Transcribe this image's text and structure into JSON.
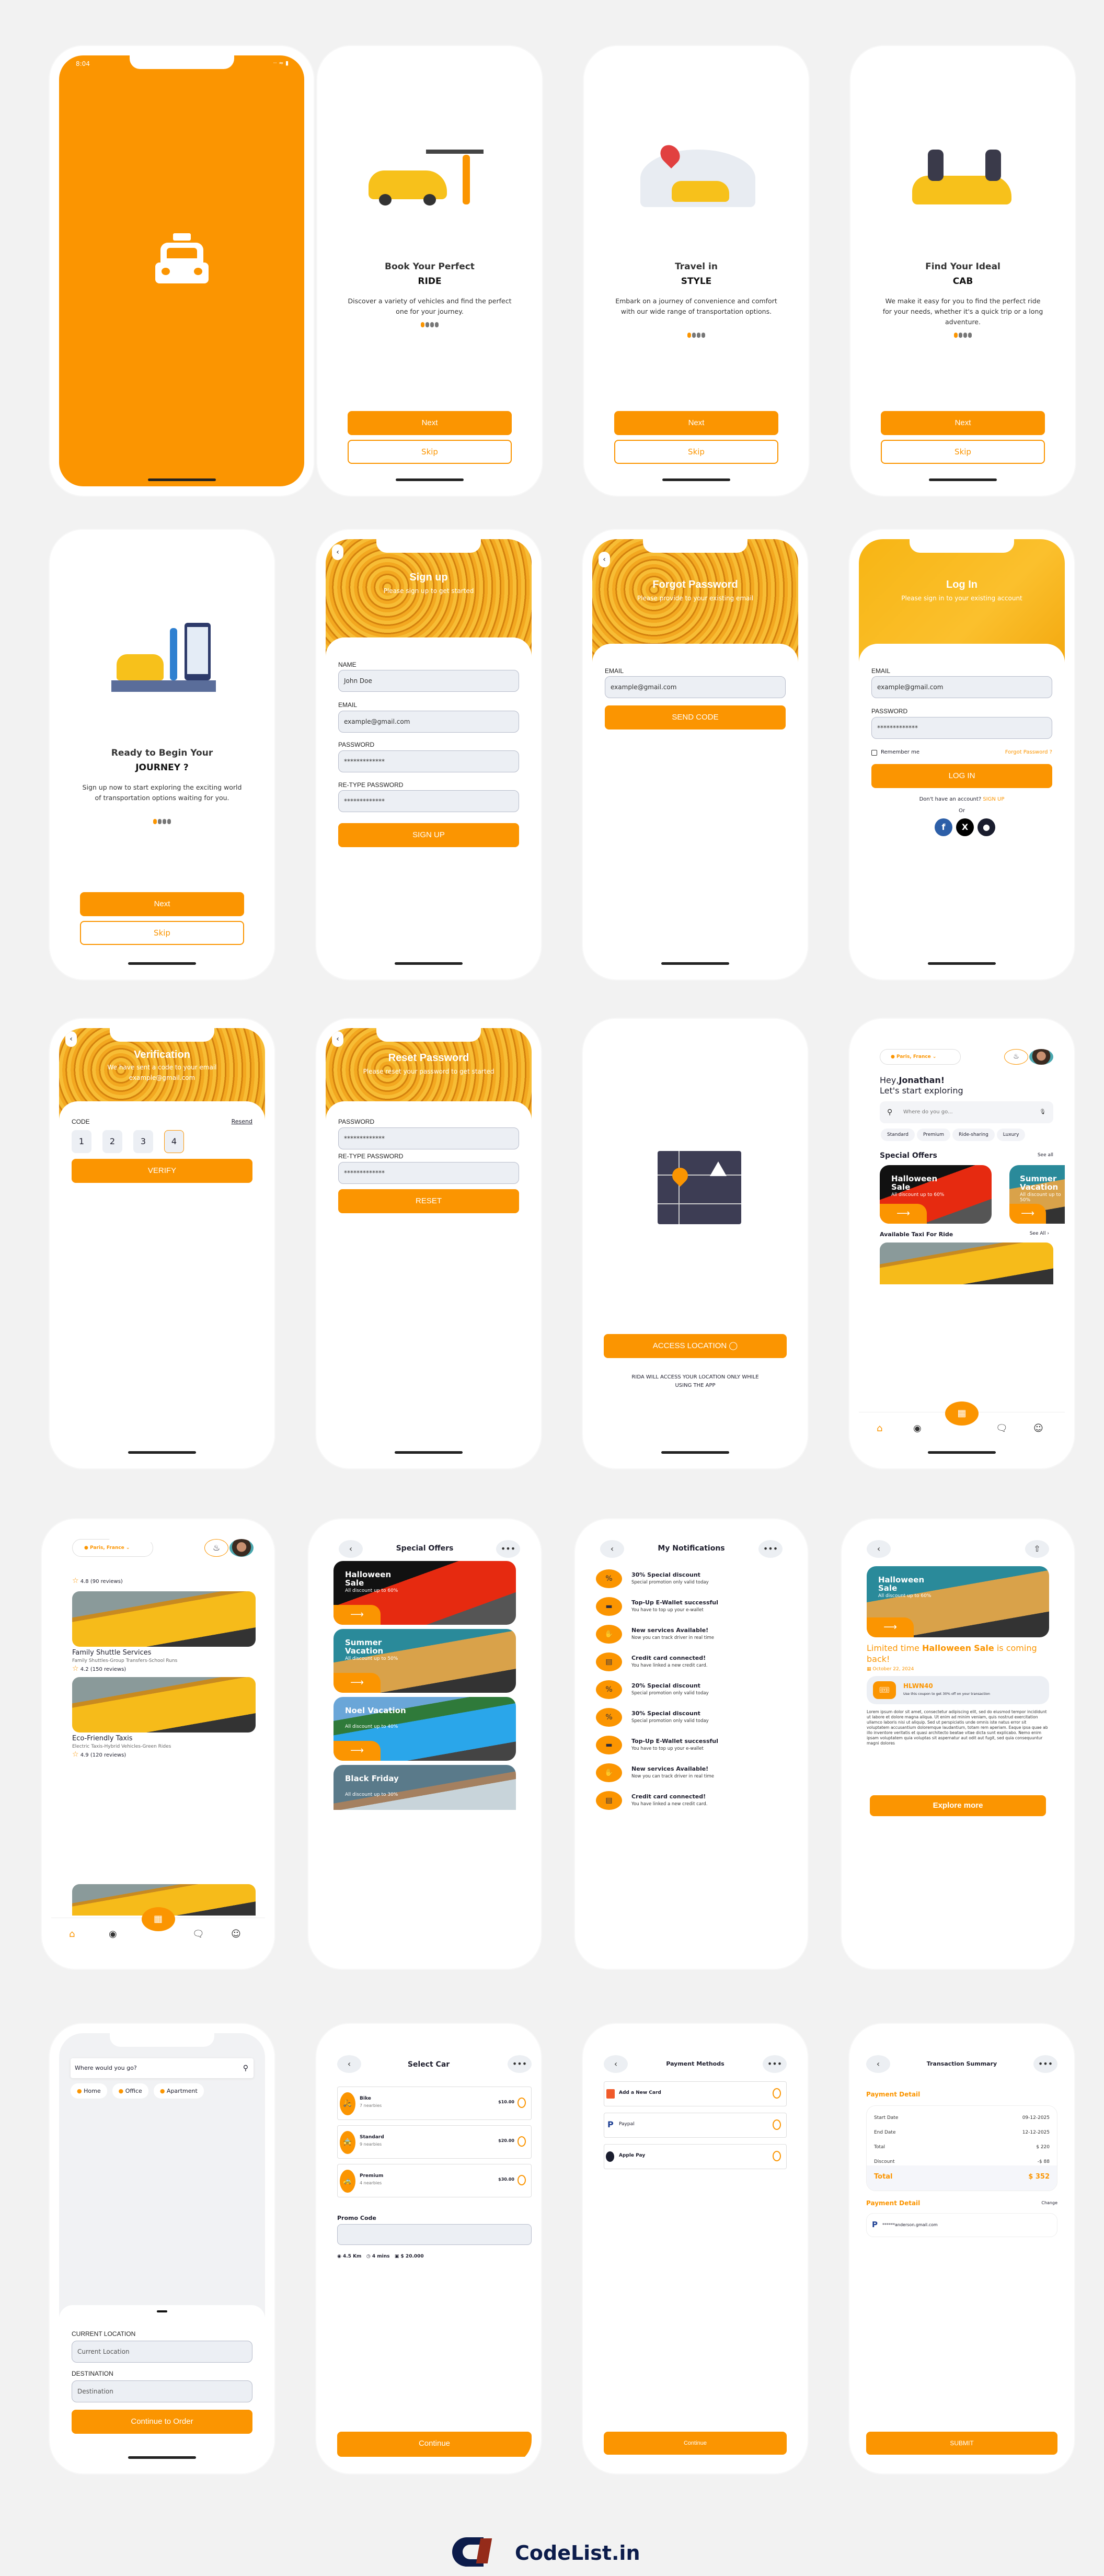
{
  "brand_color": "#FB9501",
  "splash": {
    "time": "8:04",
    "icon": "taxi-icon"
  },
  "onboarding": {
    "slides": [
      {
        "title": "Book Your Perfect",
        "highlight": "RIDE",
        "text": "Discover a variety of vehicles and find the perfect one for your journey."
      },
      {
        "title": "Travel in",
        "highlight": "STYLE",
        "text": "Embark on a journey of convenience and comfort with our wide range of transportation options."
      },
      {
        "title": "Find Your Ideal",
        "highlight": "CAB",
        "text": "We make it easy for you to find the perfect ride for your needs, whether it's a quick trip or a long adventure."
      },
      {
        "title": "Ready to Begin Your",
        "highlight": "JOURNEY ?",
        "text": "Sign up now to start exploring the exciting world of transportation options waiting for you."
      }
    ],
    "next": "Next",
    "skip": "Skip"
  },
  "signup": {
    "title": "Sign up",
    "subtitle": "Please sign up to get started",
    "name_label": "NAME",
    "name_value": "John Doe",
    "email_label": "EMAIL",
    "email_value": "example@gmail.com",
    "password_label": "PASSWORD",
    "password_value": "*************",
    "retype_label": "RE-TYPE PASSWORD",
    "retype_value": "*************",
    "button": "SIGN UP"
  },
  "forgot": {
    "title": "Forgot Password",
    "subtitle": "Please provide to your existing email",
    "email_label": "EMAIL",
    "email_value": "example@gmail.com",
    "button": "SEND CODE"
  },
  "login": {
    "title": "Log In",
    "subtitle": "Please sign in to your existing account",
    "email_label": "EMAIL",
    "email_value": "example@gmail.com",
    "password_label": "PASSWORD",
    "password_value": "*************",
    "remember": "Remember me",
    "forgot": "Forgot Password ?",
    "button": "LOG IN",
    "no_account": "Don't have an account?",
    "signup": "SIGN UP",
    "or": "Or",
    "social": [
      "facebook-icon",
      "x-icon",
      "apple-icon"
    ]
  },
  "verification": {
    "title": "Verification",
    "subtitle": "We have sent a code to your email",
    "email": "example@gmail.com",
    "code_label": "CODE",
    "resend": "Resend",
    "digits": [
      "1",
      "2",
      "3",
      "4"
    ],
    "button": "VERIFY"
  },
  "reset": {
    "title": "Reset Password",
    "subtitle": "Please reset your password to get started",
    "password_label": "PASSWORD",
    "password_value": "*************",
    "retype_label": "RE-TYPE PASSWORD",
    "retype_value": "*************",
    "button": "RESET"
  },
  "location": {
    "button": "ACCESS LOCATION",
    "note": "RIDA WILL ACCESS YOUR LOCATION ONLY WHILE USING THE APP"
  },
  "home": {
    "location": "Paris, France",
    "greeting": "Hey,",
    "name": "Jonathan!",
    "subtitle": "Let's start exploring",
    "search_placeholder": "Where do you go...",
    "chips": [
      "Standard",
      "Premium",
      "Ride-sharing",
      "Luxury"
    ],
    "offers_title": "Special Offers",
    "offers_see_all": "See all",
    "offers": [
      {
        "title": "Halloween Sale",
        "subtitle": "All discount up to 60%"
      },
      {
        "title": "Summer Vacation",
        "subtitle": "All discount up to 50%"
      }
    ],
    "taxi_title": "Available Taxi For Ride",
    "taxi_see_all": "See All"
  },
  "taxis": {
    "location": "Paris, France",
    "top_rating": {
      "rating": "4.8",
      "reviews": "(90 reviews)"
    },
    "items": [
      {
        "name": "Family Shuttle Services",
        "tags": "Family Shuttles-Group Transfers-School Runs",
        "rating": "4.2",
        "reviews": "(150 reviews)"
      },
      {
        "name": "Eco-Friendly Taxis",
        "tags": "Electric Taxis-Hybrid Vehicles-Green Rides",
        "rating": "4.9",
        "reviews": "(120 reviews)"
      }
    ]
  },
  "offers": {
    "title": "Special Offers",
    "items": [
      {
        "title": "Halloween Sale",
        "subtitle": "All discount up to 60%"
      },
      {
        "title": "Summer Vacation",
        "subtitle": "All discount up to 50%"
      },
      {
        "title": "Noel Vacation",
        "subtitle": "All discount up to 40%"
      },
      {
        "title": "Black Friday",
        "subtitle": "All discount up to 30%"
      }
    ]
  },
  "notifications": {
    "title": "My Notifications",
    "items": [
      {
        "icon": "discount-icon",
        "title": "30% Special discount",
        "text": "Special promotion only valid today"
      },
      {
        "icon": "wallet-icon",
        "title": "Top-Up E-Wallet successful",
        "text": "You have to top up your e-wallet"
      },
      {
        "icon": "hand-coin-icon",
        "title": "New services Available!",
        "text": "Now you can track driver in real time"
      },
      {
        "icon": "credit-card-icon",
        "title": "Credit card connected!",
        "text": "You have linked a new credit card."
      },
      {
        "icon": "discount-icon",
        "title": "20% Special discount",
        "text": "Special promotion only valid today"
      },
      {
        "icon": "discount-icon",
        "title": "30% Special discount",
        "text": "Special promotion only valid today"
      },
      {
        "icon": "wallet-icon",
        "title": "Top-Up E-Wallet successful",
        "text": "You have to top up your e-wallet"
      },
      {
        "icon": "hand-coin-icon",
        "title": "New services Available!",
        "text": "Now you can track driver in real time"
      },
      {
        "icon": "credit-card-icon",
        "title": "Credit card connected!",
        "text": "You have linked a new credit card."
      }
    ]
  },
  "offer_detail": {
    "banner_title": "Halloween Sale",
    "banner_subtitle": "All discount up to 60%",
    "headline_1": "Limited time ",
    "headline_bold_1": "Halloween",
    "headline_bold_2": "Sale",
    "headline_2": " is coming back!",
    "date": "October 22, 2024",
    "coupon_code": "HLWN40",
    "coupon_text": "Use this coupon to get 30% off on your transaction",
    "body": "Lorem ipsum dolor sit amet, consectetur adipiscing elit, sed do eiusmod tempor incididunt ut labore et dolore magna aliqua. Ut enim ad minim veniam, quis nostrud exercitation ullamco laboris nisi ut aliquip. Sed ut perspiciatis unde omnis iste natus error sit voluptatem accusantium doloremque laudantium, totam rem aperiam. Eaque ipsa quae ab illo inventore veritatis et quasi architecto beatae vitae dicta sunt explicabo. Nemo enim ipsam voluptatem quia voluptas sit aspernatur aut odit aut fugit, sed quia consequuntur magni dolores",
    "button": "Explore more"
  },
  "destination": {
    "search_placeholder": "Where would you go?",
    "places": [
      "Home",
      "Office",
      "Apartment"
    ],
    "current_label": "CURRENT LOCATION",
    "current_placeholder": "Current Location",
    "destination_label": "DESTINATION",
    "destination_placeholder": "Destination",
    "button": "Continue to Order"
  },
  "select_car": {
    "title": "Select Car",
    "cars": [
      {
        "name": "Bike",
        "nearby": "7 nearbies",
        "price": "$10.00"
      },
      {
        "name": "Standard",
        "nearby": "9 nearbies",
        "price": "$20.00"
      },
      {
        "name": "Premium",
        "nearby": "4 nearbies",
        "price": "$30.00"
      }
    ],
    "promo_label": "Promo Code",
    "distance": "4.5 Km",
    "time": "4 mins",
    "cost": "$ 20.000",
    "button": "Continue"
  },
  "payment_methods": {
    "title": "Payment Methods",
    "methods": [
      "Add a New Card",
      "Paypal",
      "Apple Pay"
    ],
    "button": "Continue"
  },
  "transaction": {
    "title": "Transaction Summary",
    "detail_title": "Payment Detail",
    "rows": [
      {
        "label": "Start Date",
        "value": "09-12-2025"
      },
      {
        "label": "End Date",
        "value": "12-12-2025"
      },
      {
        "label": "Total",
        "value": "$ 220"
      },
      {
        "label": "Discount",
        "value": "-$ 88"
      }
    ],
    "total_label": "Total",
    "total_value": "$ 352",
    "method_title": "Payment Detail",
    "change": "Change",
    "account": "******anderson.gmail.com",
    "button": "SUBMIT"
  },
  "footer": {
    "brand": "CodeList.in",
    "logo_text": "CodeList"
  }
}
